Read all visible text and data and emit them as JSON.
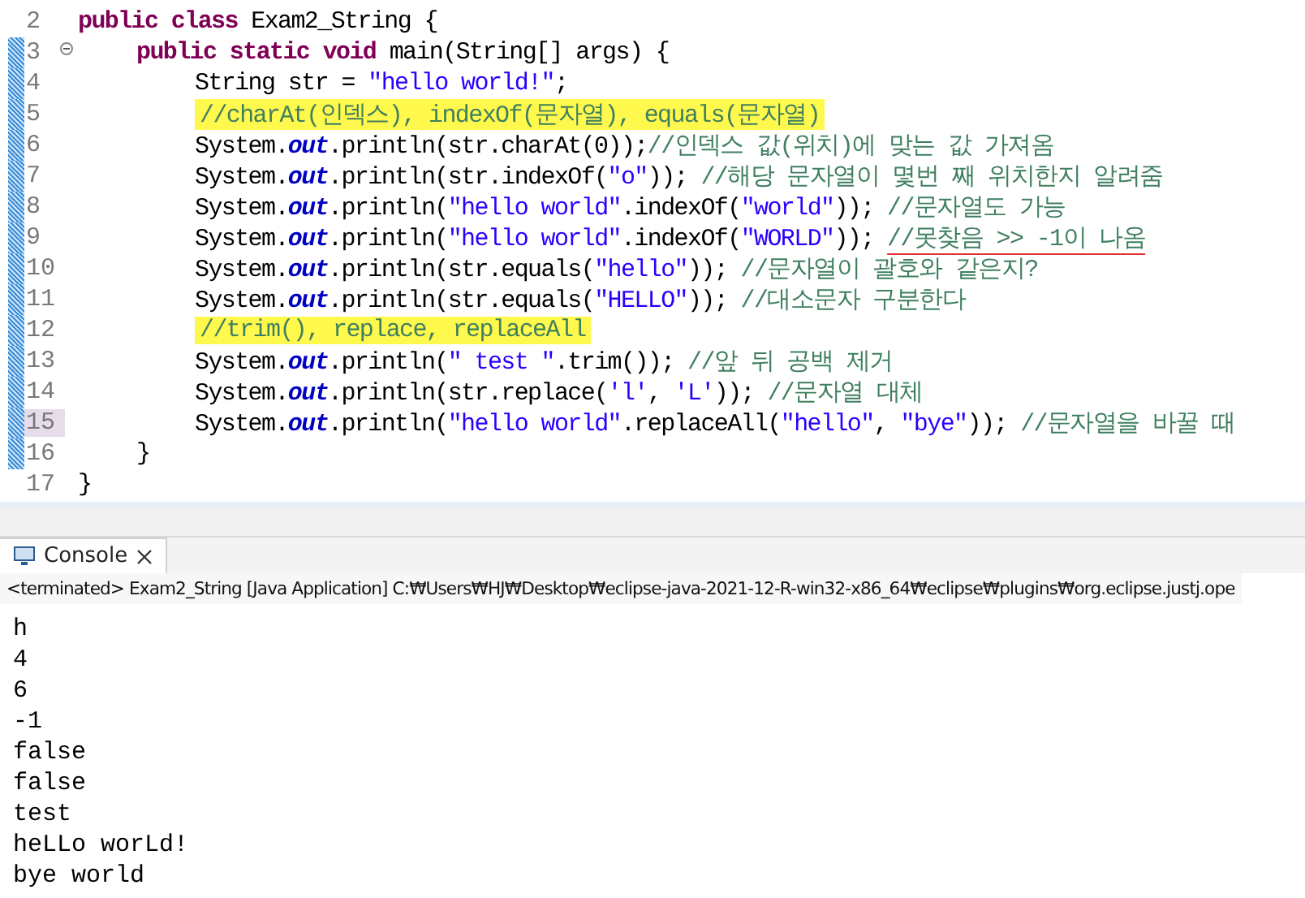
{
  "editor": {
    "lines": [
      {
        "number": "2",
        "changed": false,
        "current": false,
        "foldable": false,
        "highlight": false,
        "tokens": [
          {
            "kind": "kw",
            "text": "public class "
          },
          {
            "kind": "plain",
            "text": "Exam2_String {"
          }
        ],
        "children": [
          {
            "number": "3",
            "changed": true,
            "current": false,
            "foldable": true,
            "highlight": false,
            "tokens": [
              {
                "kind": "kw",
                "text": "public static void "
              },
              {
                "kind": "plain",
                "text": "main(String[] args) {"
              }
            ],
            "children": [
              {
                "number": "4",
                "changed": true,
                "current": false,
                "foldable": false,
                "highlight": false,
                "tokens": [
                  {
                    "kind": "plain",
                    "text": "String str = "
                  },
                  {
                    "kind": "str",
                    "text": "\"hello world!\""
                  },
                  {
                    "kind": "plain",
                    "text": ";"
                  }
                ]
              },
              {
                "number": "5",
                "changed": true,
                "current": false,
                "foldable": false,
                "highlight": true,
                "tokens": [
                  {
                    "kind": "comment",
                    "text": "//charAt(인덱스), indexOf(문자열), equals(문자열)"
                  }
                ]
              },
              {
                "number": "6",
                "changed": true,
                "current": false,
                "foldable": false,
                "highlight": false,
                "tokens": [
                  {
                    "kind": "plain",
                    "text": "System."
                  },
                  {
                    "kind": "field",
                    "text": "out"
                  },
                  {
                    "kind": "plain",
                    "text": ".println(str.charAt(0));"
                  },
                  {
                    "kind": "comment",
                    "text": "//인덱스 값(위치)에 맞는 값 가져옴"
                  }
                ]
              },
              {
                "number": "7",
                "changed": true,
                "current": false,
                "foldable": false,
                "highlight": false,
                "tokens": [
                  {
                    "kind": "plain",
                    "text": "System."
                  },
                  {
                    "kind": "field",
                    "text": "out"
                  },
                  {
                    "kind": "plain",
                    "text": ".println(str.indexOf("
                  },
                  {
                    "kind": "str",
                    "text": "\"o\""
                  },
                  {
                    "kind": "plain",
                    "text": ")); "
                  },
                  {
                    "kind": "comment",
                    "text": "//해당 문자열이 몇번 째 위치한지 알려줌"
                  }
                ]
              },
              {
                "number": "8",
                "changed": true,
                "current": false,
                "foldable": false,
                "highlight": false,
                "tokens": [
                  {
                    "kind": "plain",
                    "text": "System."
                  },
                  {
                    "kind": "field",
                    "text": "out"
                  },
                  {
                    "kind": "plain",
                    "text": ".println("
                  },
                  {
                    "kind": "str",
                    "text": "\"hello world\""
                  },
                  {
                    "kind": "plain",
                    "text": ".indexOf("
                  },
                  {
                    "kind": "str",
                    "text": "\"world\""
                  },
                  {
                    "kind": "plain",
                    "text": ")); "
                  },
                  {
                    "kind": "comment",
                    "text": "//문자열도 가능"
                  }
                ]
              },
              {
                "number": "9",
                "changed": true,
                "current": false,
                "foldable": false,
                "highlight": false,
                "tokens": [
                  {
                    "kind": "plain",
                    "text": "System."
                  },
                  {
                    "kind": "field",
                    "text": "out"
                  },
                  {
                    "kind": "plain",
                    "text": ".println("
                  },
                  {
                    "kind": "str",
                    "text": "\"hello world\""
                  },
                  {
                    "kind": "plain",
                    "text": ".indexOf("
                  },
                  {
                    "kind": "str",
                    "text": "\"WORLD\""
                  },
                  {
                    "kind": "plain",
                    "text": ")); "
                  },
                  {
                    "kind": "marked",
                    "text": "//못찾음 >> -1이 나옴"
                  }
                ]
              },
              {
                "number": "10",
                "changed": true,
                "current": false,
                "foldable": false,
                "highlight": false,
                "tokens": [
                  {
                    "kind": "plain",
                    "text": "System."
                  },
                  {
                    "kind": "field",
                    "text": "out"
                  },
                  {
                    "kind": "plain",
                    "text": ".println(str.equals("
                  },
                  {
                    "kind": "str",
                    "text": "\"hello\""
                  },
                  {
                    "kind": "plain",
                    "text": ")); "
                  },
                  {
                    "kind": "comment",
                    "text": "//문자열이 괄호와 같은지?"
                  }
                ]
              },
              {
                "number": "11",
                "changed": true,
                "current": false,
                "foldable": false,
                "highlight": false,
                "tokens": [
                  {
                    "kind": "plain",
                    "text": "System."
                  },
                  {
                    "kind": "field",
                    "text": "out"
                  },
                  {
                    "kind": "plain",
                    "text": ".println(str.equals("
                  },
                  {
                    "kind": "str",
                    "text": "\"HELLO\""
                  },
                  {
                    "kind": "plain",
                    "text": ")); "
                  },
                  {
                    "kind": "comment",
                    "text": "//대소문자 구분한다"
                  }
                ]
              },
              {
                "number": "12",
                "changed": true,
                "current": false,
                "foldable": false,
                "highlight": true,
                "tokens": [
                  {
                    "kind": "comment",
                    "text": "//trim(), replace, replaceAll"
                  }
                ]
              },
              {
                "number": "13",
                "changed": true,
                "current": false,
                "foldable": false,
                "highlight": false,
                "tokens": [
                  {
                    "kind": "plain",
                    "text": "System."
                  },
                  {
                    "kind": "field",
                    "text": "out"
                  },
                  {
                    "kind": "plain",
                    "text": ".println("
                  },
                  {
                    "kind": "str",
                    "text": "\" test \""
                  },
                  {
                    "kind": "plain",
                    "text": ".trim()); "
                  },
                  {
                    "kind": "comment",
                    "text": "//앞 뒤 공백 제거"
                  }
                ]
              },
              {
                "number": "14",
                "changed": true,
                "current": false,
                "foldable": false,
                "highlight": false,
                "tokens": [
                  {
                    "kind": "plain",
                    "text": "System."
                  },
                  {
                    "kind": "field",
                    "text": "out"
                  },
                  {
                    "kind": "plain",
                    "text": ".println(str.replace("
                  },
                  {
                    "kind": "str",
                    "text": "'l'"
                  },
                  {
                    "kind": "plain",
                    "text": ", "
                  },
                  {
                    "kind": "str",
                    "text": "'L'"
                  },
                  {
                    "kind": "plain",
                    "text": ")); "
                  },
                  {
                    "kind": "comment",
                    "text": "//문자열 대체"
                  }
                ]
              },
              {
                "number": "15",
                "changed": true,
                "current": true,
                "foldable": false,
                "highlight": false,
                "tokens": [
                  {
                    "kind": "plain",
                    "text": "System."
                  },
                  {
                    "kind": "field",
                    "text": "out"
                  },
                  {
                    "kind": "plain",
                    "text": ".println("
                  },
                  {
                    "kind": "str",
                    "text": "\"hello world\""
                  },
                  {
                    "kind": "plain",
                    "text": ".replaceAll("
                  },
                  {
                    "kind": "str",
                    "text": "\"hello\""
                  },
                  {
                    "kind": "plain",
                    "text": ", "
                  },
                  {
                    "kind": "str",
                    "text": "\"bye\""
                  },
                  {
                    "kind": "plain",
                    "text": ")); "
                  },
                  {
                    "kind": "comment",
                    "text": "//문자열을 바꿀 때"
                  }
                ]
              }
            ]
          },
          {
            "number": "16",
            "changed": true,
            "current": false,
            "foldable": false,
            "highlight": false,
            "tokens": [
              {
                "kind": "plain",
                "text": "}"
              }
            ]
          }
        ]
      },
      {
        "number": "17",
        "changed": false,
        "current": false,
        "foldable": false,
        "highlight": false,
        "tokens": [
          {
            "kind": "plain",
            "text": "}"
          }
        ]
      }
    ]
  },
  "console": {
    "tab": {
      "label": "Console",
      "selected": true
    },
    "status": "<terminated> Exam2_String [Java Application] C:₩Users₩HJ₩Desktop₩eclipse-java-2021-12-R-win32-x86_64₩eclipse₩plugins₩org.eclipse.justj.ope",
    "output": [
      "h",
      "4",
      "6",
      "-1",
      "false",
      "false",
      "test",
      "heLLo worLd!",
      "bye world"
    ]
  }
}
